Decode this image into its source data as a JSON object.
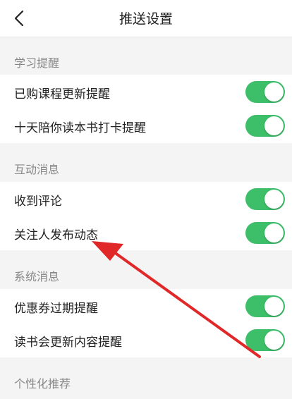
{
  "header": {
    "title": "推送设置",
    "back_icon": "chevron-left-icon"
  },
  "accent_color": "#3cbf68",
  "annotation_color": "#e02828",
  "sections": [
    {
      "title": "学习提醒",
      "items": [
        {
          "label": "已购课程更新提醒",
          "enabled": true
        },
        {
          "label": "十天陪你读本书打卡提醒",
          "enabled": true
        }
      ]
    },
    {
      "title": "互动消息",
      "items": [
        {
          "label": "收到评论",
          "enabled": true
        },
        {
          "label": "关注人发布动态",
          "enabled": true
        }
      ]
    },
    {
      "title": "系统消息",
      "items": [
        {
          "label": "优惠券过期提醒",
          "enabled": true
        },
        {
          "label": "读书会更新内容提醒",
          "enabled": true
        }
      ]
    },
    {
      "title": "个性化推荐",
      "items": []
    }
  ]
}
